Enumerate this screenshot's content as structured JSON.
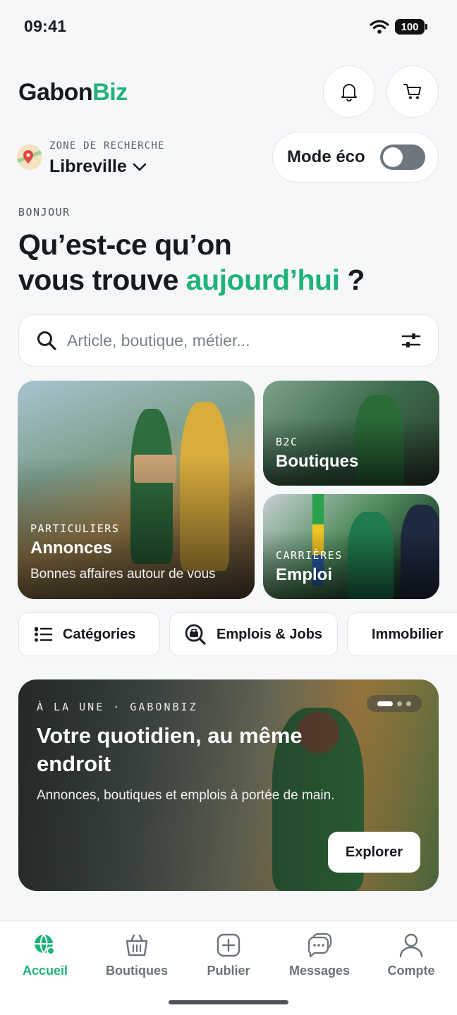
{
  "status": {
    "time": "09:41",
    "battery": "100"
  },
  "header": {
    "brand_part1": "Gabon",
    "brand_part2": "Biz"
  },
  "location": {
    "label": "ZONE DE RECHERCHE",
    "city": "Libreville"
  },
  "eco_mode": {
    "label": "Mode éco",
    "enabled": false
  },
  "greeting": {
    "eyebrow": "BONJOUR",
    "line1": "Qu’est-ce qu’on",
    "line2_start": "vous trouve ",
    "line2_accent": "aujourd’hui",
    "line2_end": " ?"
  },
  "search": {
    "placeholder": "Article, boutique, métier..."
  },
  "cards": {
    "annonces": {
      "eyebrow": "PARTICULIERS",
      "title": "Annonces",
      "subtitle": "Bonnes affaires autour de vous"
    },
    "boutiques": {
      "eyebrow": "B2C",
      "title": "Boutiques"
    },
    "emploi": {
      "eyebrow": "CARRIÈRES",
      "title": "Emploi"
    }
  },
  "chips": [
    {
      "label": "Catégories",
      "icon": "list-icon"
    },
    {
      "label": "Emplois & Jobs",
      "icon": "job-search-icon"
    },
    {
      "label": "Immobilier",
      "icon": "house-icon"
    }
  ],
  "banner": {
    "eyebrow": "À LA UNE · GABONBIZ",
    "title": "Votre quotidien, au même endroit",
    "subtitle": "Annonces, boutiques et emplois à portée de main.",
    "cta": "Explorer",
    "slides": 3,
    "active_slide": 1
  },
  "nav": [
    {
      "label": "Accueil",
      "icon": "globe-icon",
      "active": true
    },
    {
      "label": "Boutiques",
      "icon": "basket-icon",
      "active": false
    },
    {
      "label": "Publier",
      "icon": "plus-square-icon",
      "active": false
    },
    {
      "label": "Messages",
      "icon": "chat-icon",
      "active": false
    },
    {
      "label": "Compte",
      "icon": "user-icon",
      "active": false
    }
  ],
  "colors": {
    "accent": "#1fb37a",
    "text": "#16191d",
    "background": "#f6f7f9"
  }
}
